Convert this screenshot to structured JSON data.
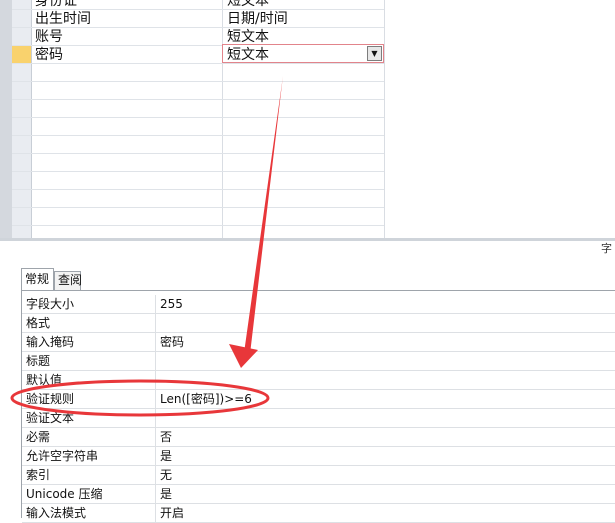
{
  "fields": [
    {
      "name": "身份证",
      "type": "短文本",
      "active": false
    },
    {
      "name": "出生时间",
      "type": "日期/时间",
      "active": false
    },
    {
      "name": "账号",
      "type": "短文本",
      "active": false
    },
    {
      "name": "密码",
      "type": "短文本",
      "active": true
    }
  ],
  "side_label": "字",
  "tabs": {
    "general": "常规",
    "lookup": "查阅"
  },
  "properties": [
    {
      "name": "字段大小",
      "value": "255"
    },
    {
      "name": "格式",
      "value": ""
    },
    {
      "name": "输入掩码",
      "value": "密码"
    },
    {
      "name": "标题",
      "value": ""
    },
    {
      "name": "默认值",
      "value": ""
    },
    {
      "name": "验证规则",
      "value": "Len([密码])>=6"
    },
    {
      "name": "验证文本",
      "value": ""
    },
    {
      "name": "必需",
      "value": "否"
    },
    {
      "name": "允许空字符串",
      "value": "是"
    },
    {
      "name": "索引",
      "value": "无"
    },
    {
      "name": "Unicode 压缩",
      "value": "是"
    },
    {
      "name": "输入法模式",
      "value": "开启"
    }
  ],
  "colors": {
    "annotation": "#e8373a",
    "selected_row": "#f9d26d"
  }
}
